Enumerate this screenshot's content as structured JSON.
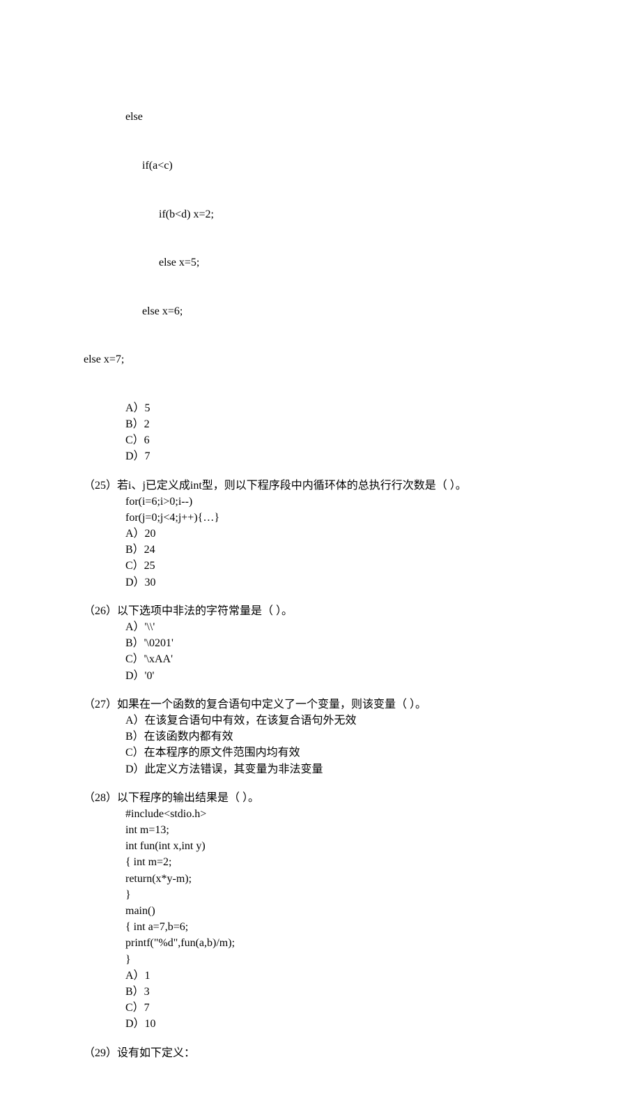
{
  "q24_tail": {
    "code": [
      "else",
      "      if(a<c)",
      "            if(b<d) x=2;",
      "            else x=5;",
      "      else x=6;",
      "else x=7;"
    ],
    "options": [
      "A）5",
      "B）2",
      "C）6",
      "D）7"
    ]
  },
  "q25": {
    "num": "（25）",
    "stem": "若i、j已定义成int型，则以下程序段中内循环体的总执行行次数是（        ）。",
    "code": [
      "for(i=6;i>0;i--)",
      "for(j=0;j<4;j++){…}"
    ],
    "options": [
      "A）20",
      "B）24",
      "C）25",
      "D）30"
    ]
  },
  "q26": {
    "num": "（26）",
    "stem": "以下选项中非法的字符常量是（        ）。",
    "options": [
      "A）'\\\\'",
      "B）'\\0201'",
      "C）'\\xAA'",
      "D）'0'"
    ]
  },
  "q27": {
    "num": "（27）",
    "stem": "如果在一个函数的复合语句中定义了一个变量，则该变量（        ）。",
    "options": [
      "A）在该复合语句中有效，在该复合语句外无效",
      "B）在该函数内都有效",
      "C）在本程序的原文件范围内均有效",
      "D）此定义方法错误，其变量为非法变量"
    ]
  },
  "q28": {
    "num": "（28）",
    "stem": "以下程序的输出结果是（        ）。",
    "code": [
      "#include<stdio.h>",
      "int m=13;",
      "int fun(int x,int y)",
      "{   int m=2;",
      "    return(x*y-m);",
      "}",
      "main()",
      "{   int a=7,b=6;",
      "    printf(\"%d\",fun(a,b)/m);",
      "}"
    ],
    "options": [
      "A）1",
      "B）3",
      "C）7",
      "D）10"
    ]
  },
  "q29": {
    "num": "（29）",
    "stem": "设有如下定义："
  }
}
